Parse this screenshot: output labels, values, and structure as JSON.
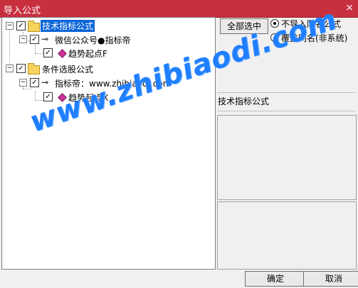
{
  "window": {
    "title": "导入公式",
    "close_glyph": "×"
  },
  "tree": {
    "nodes": [
      {
        "label": "技术指标公式",
        "checked": true
      },
      {
        "label": "微信公众号●指标帝",
        "checked": true
      },
      {
        "label": "趋势起点F",
        "checked": true
      },
      {
        "label": "条件选股公式",
        "checked": true
      },
      {
        "label": "指标帝：www.zhibiaodi.com",
        "checked": true
      },
      {
        "label": "趋势起点X",
        "checked": true
      }
    ],
    "check_glyph": "✓",
    "expand_glyph": "−"
  },
  "right_panel": {
    "select_all_label": "全部选中",
    "radio_options": [
      {
        "label": "不导入同名公式",
        "selected": true
      },
      {
        "label": "覆盖同名(非系统)",
        "selected": false
      }
    ],
    "formula_type_label": "技术指标公式"
  },
  "buttons": {
    "ok": "确定",
    "cancel": "取消"
  },
  "watermark": "www.zhibiaodi.com",
  "colors": {
    "titlebar": "#c8303f",
    "selection": "#0a64d8",
    "watermark": "#1f7fff"
  }
}
